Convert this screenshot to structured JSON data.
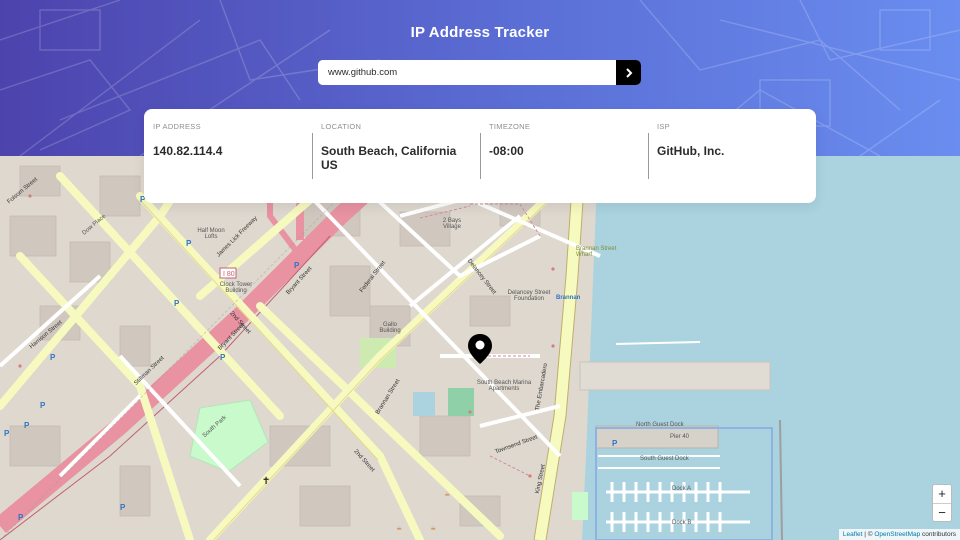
{
  "app": {
    "title": "IP Address Tracker"
  },
  "search": {
    "value": "www.github.com",
    "button_icon": "chevron-right-icon"
  },
  "info": {
    "ip_label": "IP ADDRESS",
    "ip_value": "140.82.114.4",
    "location_label": "LOCATION",
    "location_value": "South Beach, California US",
    "timezone_label": "TIMEZONE",
    "timezone_value": "-08:00",
    "isp_label": "ISP",
    "isp_value": "GitHub, Inc."
  },
  "map": {
    "zoom_in": "+",
    "zoom_out": "−",
    "attribution_leaflet": "Leaflet",
    "attribution_sep": " | © ",
    "attribution_osm": "OpenStreetMap",
    "attribution_suffix": " contributors",
    "labels": {
      "brannan_st": "Brannan Street",
      "delancey_st": "Delancey Street",
      "bryant_st": "Bryant Street",
      "second_st": "2nd Street",
      "embarcadero": "The Embarcadero",
      "king_st": "King Street",
      "townsend_st": "Townsend Street",
      "federal_st": "Federal Street",
      "south_beach_marina": "South Beach Marina Apartments",
      "brannan_wharf": "Brannan Street Wharf",
      "south_park": "South Park",
      "north_guest_dock": "North Guest Dock",
      "south_guest_dock": "South Guest Dock",
      "dock_a": "Dock A",
      "dock_b": "Dock B",
      "james_lick": "James Lick Freeway",
      "half_moon": "Half Moon Lofts",
      "clock_tower": "Clock Tower Building",
      "delancey_found": "Delancey Street Foundation",
      "gallo": "Gallo Building",
      "folsom": "Folsom Street",
      "harrison": "Harrison Street",
      "dow_place": "Dow Place",
      "stillman": "Stillman Street",
      "pier": "Pier 40",
      "two_bays": "2 Bays Village",
      "brannan_stop": "Brannan"
    }
  }
}
